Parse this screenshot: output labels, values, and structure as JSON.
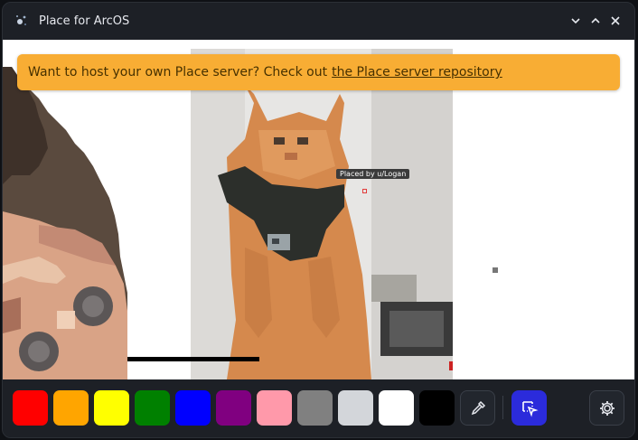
{
  "window": {
    "title": "Place for ArcOS"
  },
  "banner": {
    "text": "Want to host your own Place server? Check out",
    "link_text": "the Place server repository"
  },
  "canvas": {
    "tooltip": "Placed by u/Logan"
  },
  "palette": {
    "colors": [
      "#ff0000",
      "#ffa500",
      "#ffff00",
      "#008000",
      "#0000ff",
      "#800080",
      "#ff99aa",
      "#808080",
      "#d3d6da",
      "#ffffff",
      "#000000"
    ]
  },
  "toolbar": {
    "eyedropper_icon": "eyedropper-icon",
    "select_icon": "cursor-select-icon",
    "settings_icon": "gear-icon",
    "accent": "#2b2bdb"
  }
}
